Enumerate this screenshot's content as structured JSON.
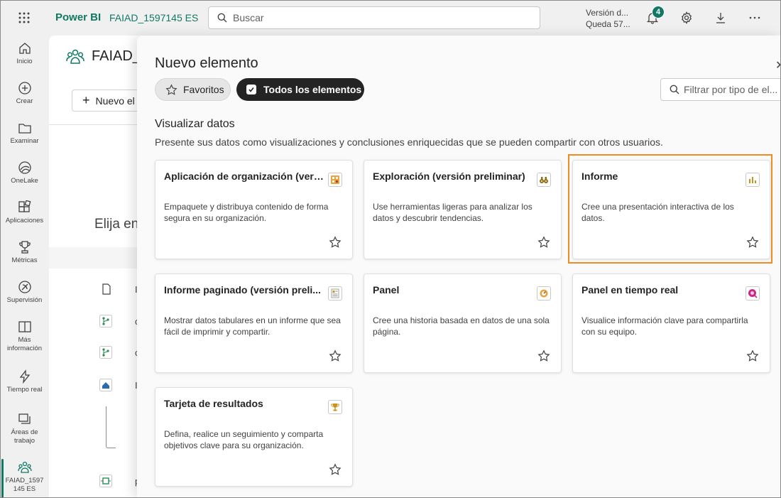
{
  "topbar": {
    "brand": "Power BI",
    "workspace": "FAIAD_1597145 ES",
    "search_placeholder": "Buscar",
    "version_line1": "Versión d...",
    "version_line2": "Queda 57...",
    "notification_count": "4",
    "icons": [
      "waffle-icon",
      "search-icon",
      "bell-icon",
      "gear-icon",
      "download-icon",
      "more-icon"
    ]
  },
  "leftnav": {
    "items": [
      {
        "label": "Inicio",
        "icon": "home-icon"
      },
      {
        "label": "Crear",
        "icon": "create-icon"
      },
      {
        "label": "Examinar",
        "icon": "folder-icon"
      },
      {
        "label": "OneLake",
        "icon": "onelake-icon"
      },
      {
        "label": "Aplicaciones",
        "icon": "apps-icon"
      },
      {
        "label": "Métricas",
        "icon": "trophy-icon"
      },
      {
        "label": "Supervisión",
        "icon": "monitor-icon"
      },
      {
        "label": "Más",
        "label2": "información",
        "icon": "book-icon"
      },
      {
        "label": "Tiempo real",
        "icon": "lightning-icon"
      },
      {
        "label": "Áreas de",
        "label2": "trabajo",
        "icon": "workspaces-icon"
      },
      {
        "label": "FAIAD_1597",
        "label2": "145 ES",
        "icon": "workspace-people-icon"
      }
    ]
  },
  "workspace": {
    "title": "FAIAD_",
    "new_button": "Nuevo el",
    "choose_text": "Elija en",
    "rows": [
      "I",
      "c",
      "c",
      "I",
      "p"
    ]
  },
  "panel": {
    "title": "Nuevo elemento",
    "tabs": [
      {
        "label": "Favoritos",
        "selected": false
      },
      {
        "label": "Todos los elementos",
        "selected": true
      }
    ],
    "filter_placeholder": "Filtrar por tipo de el...",
    "section_title": "Visualizar datos",
    "section_desc": "Presente sus datos como visualizaciones y conclusiones enriquecidas que se pueden compartir con otros usuarios.",
    "cards": [
      {
        "title": "Aplicación de organización (vers...",
        "desc": "Empaquete y distribuya contenido de forma segura en su organización.",
        "icon": "org-app-icon",
        "color": "#e8a33d"
      },
      {
        "title": "Exploración (versión preliminar)",
        "desc": "Use herramientas ligeras para analizar los datos y descubrir tendencias.",
        "icon": "binoculars-icon",
        "color": "#8a6d1e"
      },
      {
        "title": "Informe",
        "desc": "Cree una presentación interactiva de los datos.",
        "icon": "report-icon",
        "color": "#c8931f",
        "highlighted": true
      },
      {
        "title": "Informe paginado (versión preli...",
        "desc": "Mostrar datos tabulares en un informe que sea fácil de imprimir y compartir.",
        "icon": "paginated-report-icon",
        "color": "#c8931f"
      },
      {
        "title": "Panel",
        "desc": "Cree una historia basada en datos de una sola página.",
        "icon": "dashboard-icon",
        "color": "#e8a33d"
      },
      {
        "title": "Panel en tiempo real",
        "desc": "Visualice información clave para compartirla con su equipo.",
        "icon": "realtime-dashboard-icon",
        "color": "#c7288a"
      },
      {
        "title": "Tarjeta de resultados",
        "desc": "Defina, realice un seguimiento y comparta objetivos clave para su organización.",
        "icon": "scorecard-icon",
        "color": "#c8931f"
      }
    ]
  }
}
